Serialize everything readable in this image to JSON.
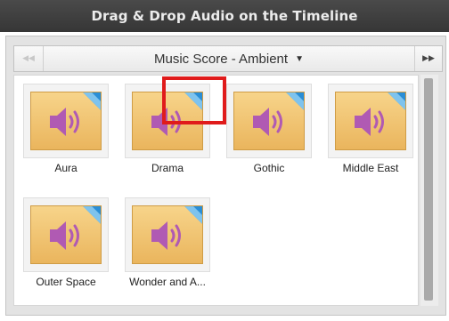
{
  "window": {
    "title": "Drag & Drop Audio on the Timeline"
  },
  "category": {
    "selected": "Music Score - Ambient",
    "prev_glyph": "◀◀",
    "next_glyph": "▶▶",
    "dropdown_glyph": "▼"
  },
  "items": [
    {
      "label": "Aura"
    },
    {
      "label": "Drama"
    },
    {
      "label": "Gothic"
    },
    {
      "label": "Middle East"
    },
    {
      "label": "Outer Space"
    },
    {
      "label": "Wonder and A..."
    }
  ],
  "icons": {
    "tile": "speaker-icon",
    "corner": "blue-corner-icon"
  },
  "colors": {
    "highlight": "#e01b1b",
    "tile": "#f0c274",
    "speaker": "#b05ab3",
    "corner": "#2a8ed6"
  }
}
